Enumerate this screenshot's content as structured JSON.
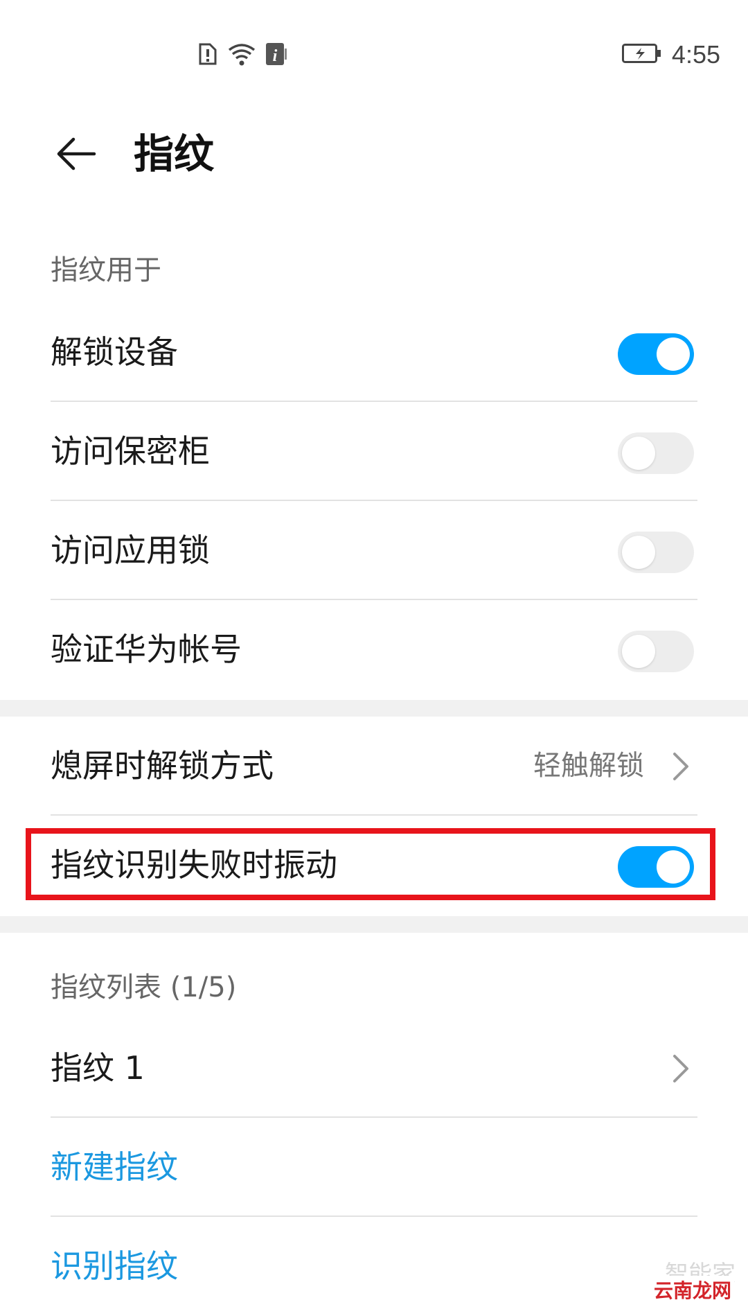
{
  "status_bar": {
    "time": "4:55",
    "icons": [
      "sim-alert-icon",
      "wifi-icon",
      "info-icon",
      "battery-charging-icon"
    ]
  },
  "header": {
    "title": "指纹",
    "back_icon": "arrow-left-icon"
  },
  "section_usage": {
    "title": "指纹用于",
    "items": [
      {
        "label": "解锁设备",
        "enabled": true
      },
      {
        "label": "访问保密柜",
        "enabled": false
      },
      {
        "label": "访问应用锁",
        "enabled": false
      },
      {
        "label": "验证华为帐号",
        "enabled": false
      }
    ]
  },
  "section_settings": {
    "screen_off_unlock": {
      "label": "熄屏时解锁方式",
      "value": "轻触解锁"
    },
    "vibrate_on_fail": {
      "label": "指纹识别失败时振动",
      "enabled": true
    }
  },
  "section_list": {
    "title": "指纹列表 (1/5)",
    "items": [
      {
        "label": "指纹 1"
      }
    ],
    "actions": {
      "new_label": "新建指纹",
      "identify_label": "识别指纹"
    }
  },
  "watermark": {
    "line1": "智能家",
    "line2": "云南龙网"
  },
  "colors": {
    "accent": "#00a3ff",
    "link": "#1b98e0",
    "highlight": "#e8141b"
  }
}
